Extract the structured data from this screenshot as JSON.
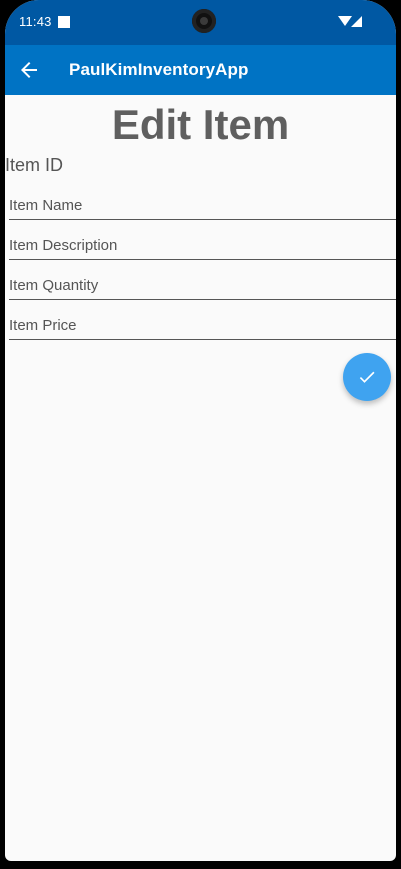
{
  "status_bar": {
    "time": "11:43",
    "icons": [
      "notification-square-icon",
      "camera-icon",
      "wifi-icon",
      "signal-icon"
    ]
  },
  "app_bar": {
    "back_icon": "arrow-left-icon",
    "title": "PaulKimInventoryApp",
    "color": "#0073c4"
  },
  "main": {
    "page_title": "Edit Item",
    "item_id_label": "Item ID",
    "fields": {
      "name": {
        "placeholder": "Item Name",
        "value": ""
      },
      "description": {
        "placeholder": "Item Description",
        "value": ""
      },
      "quantity": {
        "placeholder": "Item Quantity",
        "value": ""
      },
      "price": {
        "placeholder": "Item Price",
        "value": ""
      }
    },
    "fab": {
      "icon": "check-icon",
      "color": "#3fa3f0"
    }
  }
}
